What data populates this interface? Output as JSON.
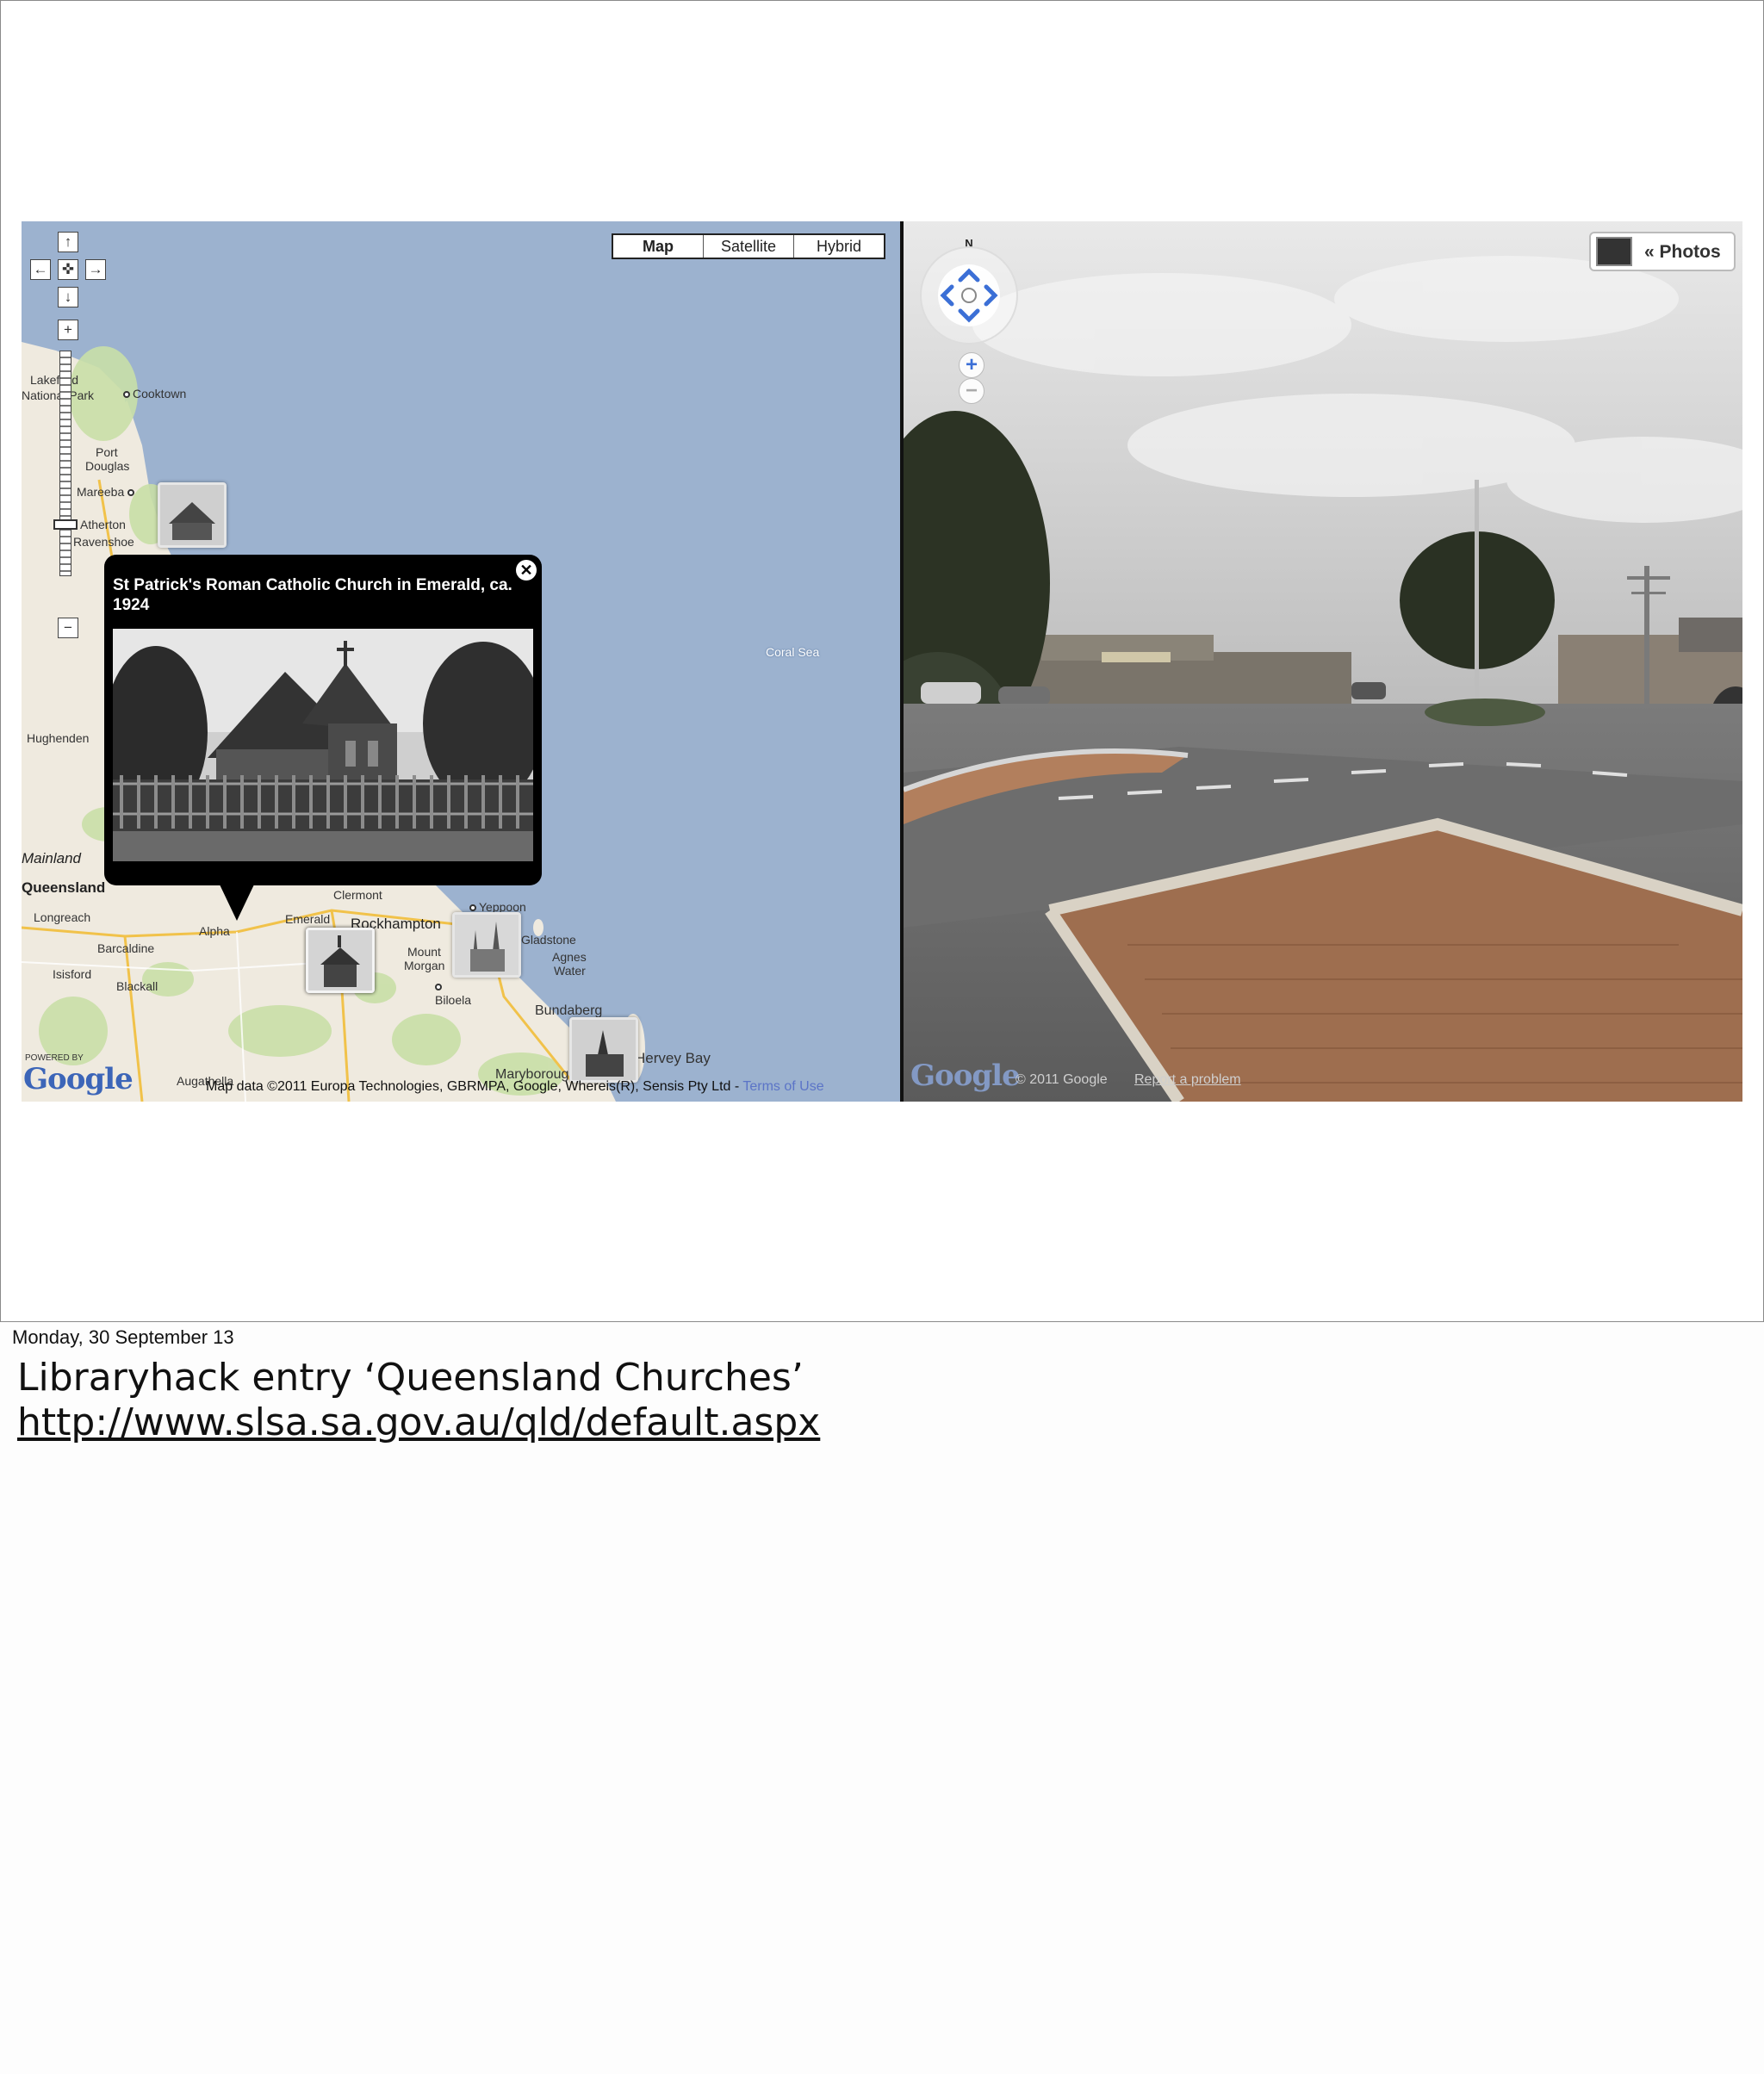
{
  "map": {
    "types": [
      "Map",
      "Satellite",
      "Hybrid"
    ],
    "active_type": "Map",
    "labels": {
      "cooktown": "Cooktown",
      "lakefield": "Lakefield",
      "national_park": "National Park",
      "port_douglas_1": "Port",
      "port_douglas_2": "Douglas",
      "mareeba": "Mareeba",
      "atherton": "Atherton",
      "ravenshoe": "Ravenshoe",
      "coral_sea": "Coral Sea",
      "hughenden": "Hughenden",
      "mainland": "Mainland",
      "queensland": "Queensland",
      "longreach": "Longreach",
      "barcaldine": "Barcaldine",
      "alpha": "Alpha",
      "isisford": "Isisford",
      "blackall": "Blackall",
      "emerald": "Emerald",
      "clermont": "Clermont",
      "rockhampton": "Rockhampton",
      "yeppoon": "Yeppoon",
      "mount_morgan_1": "Mount",
      "mount_morgan_2": "Morgan",
      "gladstone": "Gladstone",
      "agnes_water_1": "Agnes",
      "agnes_water_2": "Water",
      "biloela": "Biloela",
      "bundaberg": "Bundaberg",
      "maryborough": "Maryborough",
      "hervey_bay": "Hervey Bay",
      "augathella": "Augathella"
    },
    "popup": {
      "title": "St Patrick's Roman Catholic Church in Emerald, ca. 1924",
      "close": "✕"
    },
    "powered_by": "POWERED BY",
    "logo": "Google",
    "attribution": "Map data ©2011 Europa Technologies, GBRMPA, Google, Whereis(R), Sensis Pty Ltd - ",
    "terms": "Terms of Use"
  },
  "streetview": {
    "compass_n": "N",
    "zoom_in": "+",
    "zoom_out": "−",
    "photos_label": "« Photos",
    "logo": "Google",
    "copyright": "© 2011 Google",
    "report": "Report a problem"
  },
  "notes": {
    "date": "Monday, 30 September 13",
    "title": "Libraryhack entry ‘Queensland Churches’",
    "url": "http://www.slsa.sa.gov.au/qld/default.aspx"
  },
  "icons": [
    "pan-up-icon",
    "pan-left-icon",
    "pan-center-icon",
    "pan-right-icon",
    "pan-down-icon",
    "zoom-in-icon",
    "zoom-out-icon",
    "close-icon",
    "compass-icon",
    "photos-icon"
  ]
}
